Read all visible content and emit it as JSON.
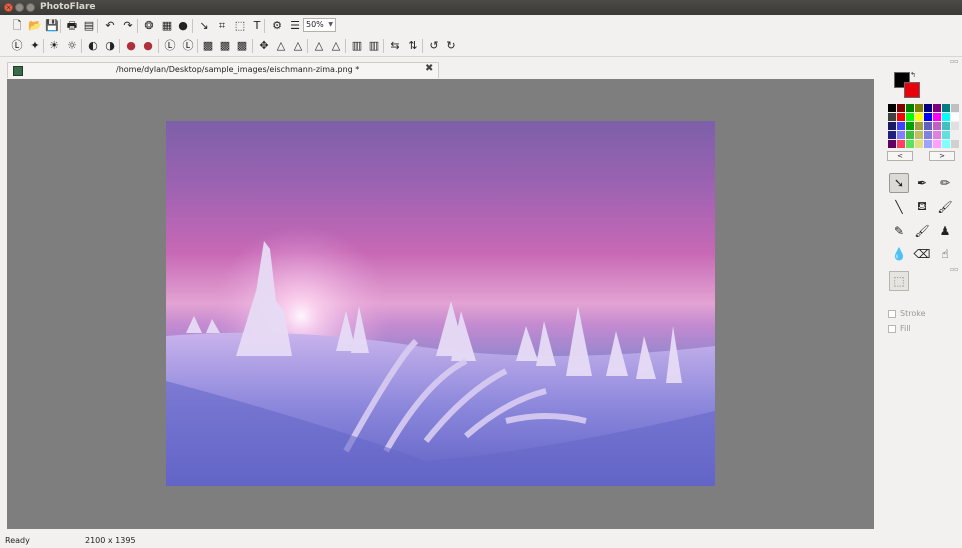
{
  "window": {
    "title": "PhotoFlare"
  },
  "toolbar1": [
    {
      "name": "new-file-icon",
      "glyph": "🗋"
    },
    {
      "name": "open-folder-icon",
      "glyph": "📂"
    },
    {
      "name": "save-icon",
      "glyph": "💾"
    },
    {
      "name": "print-icon",
      "glyph": "🖶"
    },
    {
      "name": "print-preview-icon",
      "glyph": "▤"
    },
    {
      "name": "undo-icon",
      "glyph": "↶"
    },
    {
      "name": "redo-icon",
      "glyph": "↷"
    },
    {
      "name": "color-balance-icon",
      "glyph": "❂"
    },
    {
      "name": "mosaic-icon",
      "glyph": "▦"
    },
    {
      "name": "rgb-icon",
      "glyph": "●"
    },
    {
      "name": "pointer-tool-icon",
      "glyph": "↘"
    },
    {
      "name": "crop-icon",
      "glyph": "⌗"
    },
    {
      "name": "resize-icon",
      "glyph": "⬚"
    },
    {
      "name": "text-icon",
      "glyph": "T"
    },
    {
      "name": "settings-gear-icon",
      "glyph": "⚙"
    },
    {
      "name": "layers-icon",
      "glyph": "☰"
    }
  ],
  "zoom": {
    "value": "50%"
  },
  "toolbar2": [
    {
      "name": "auto-levels-icon",
      "glyph": "Ⓛ"
    },
    {
      "name": "auto-contrast-icon",
      "glyph": "✦"
    },
    {
      "name": "brightness-up-icon",
      "glyph": "☀"
    },
    {
      "name": "brightness-down-icon",
      "glyph": "☼"
    },
    {
      "name": "contrast-up-icon",
      "glyph": "◐"
    },
    {
      "name": "contrast-down-icon",
      "glyph": "◑"
    },
    {
      "name": "saturation-up-icon",
      "glyph": "●"
    },
    {
      "name": "saturation-down-icon",
      "glyph": "●"
    },
    {
      "name": "gamma-up-icon",
      "glyph": "Ⓛ"
    },
    {
      "name": "gamma-down-icon",
      "glyph": "Ⓛ"
    },
    {
      "name": "grayscale-icon",
      "glyph": "▩"
    },
    {
      "name": "sepia-icon",
      "glyph": "▩"
    },
    {
      "name": "oil-paint-icon",
      "glyph": "▩"
    },
    {
      "name": "move-icon",
      "glyph": "✥"
    },
    {
      "name": "sharpen-icon",
      "glyph": "△"
    },
    {
      "name": "soften-icon",
      "glyph": "△"
    },
    {
      "name": "blur-icon",
      "glyph": "△"
    },
    {
      "name": "emboss-icon",
      "glyph": "△"
    },
    {
      "name": "gradient-color-icon",
      "glyph": "▥"
    },
    {
      "name": "gradient-gray-icon",
      "glyph": "▥"
    },
    {
      "name": "flip-horizontal-icon",
      "glyph": "⇆"
    },
    {
      "name": "flip-vertical-icon",
      "glyph": "⇅"
    },
    {
      "name": "rotate-ccw-icon",
      "glyph": "↺"
    },
    {
      "name": "rotate-cw-icon",
      "glyph": "↻"
    }
  ],
  "tab": {
    "title": "/home/dylan/Desktop/sample_images/eischmann-zima.png *",
    "close": "✖"
  },
  "colors": {
    "foreground": "#000000",
    "background": "#e8000c"
  },
  "palette": {
    "swatches": [
      "#000000",
      "#800000",
      "#008000",
      "#808000",
      "#000080",
      "#800080",
      "#008080",
      "#c0c0c0",
      "#404040",
      "#ff0000",
      "#00ff00",
      "#ffff00",
      "#0000ff",
      "#ff00ff",
      "#00ffff",
      "#ffffff",
      "#1a1a60",
      "#4040ff",
      "#00a000",
      "#a0a040",
      "#6060c0",
      "#c060c0",
      "#40c0c0",
      "#e0e0e0",
      "#202080",
      "#8080ff",
      "#40c040",
      "#c0c060",
      "#8080e0",
      "#e080e0",
      "#60e0e0",
      "#f0f0f0",
      "#600060",
      "#ff4060",
      "#60e060",
      "#e0e080",
      "#a0a0ff",
      "#ffa0ff",
      "#80ffff",
      "#d0d0d0"
    ],
    "prev_label": "<",
    "next_label": ">"
  },
  "tools": [
    {
      "name": "pointer-tool-icon",
      "glyph": "➘"
    },
    {
      "name": "eyedropper-tool-icon",
      "glyph": "✒"
    },
    {
      "name": "magic-wand-tool-icon",
      "glyph": "✏"
    },
    {
      "name": "line-tool-icon",
      "glyph": "╲"
    },
    {
      "name": "paint-bucket-tool-icon",
      "glyph": "⛾"
    },
    {
      "name": "spray-tool-icon",
      "glyph": "🖌"
    },
    {
      "name": "pencil-tool-icon",
      "glyph": "✎"
    },
    {
      "name": "brush-tool-icon",
      "glyph": "🖌"
    },
    {
      "name": "stamp-tool-icon",
      "glyph": "♟"
    },
    {
      "name": "blur-drop-tool-icon",
      "glyph": "💧"
    },
    {
      "name": "eraser-tool-icon",
      "glyph": "⌫"
    },
    {
      "name": "smudge-tool-icon",
      "glyph": "☝"
    },
    {
      "name": "select-rect-tool-icon",
      "glyph": "⬚"
    }
  ],
  "options": {
    "stroke_label": "Stroke",
    "fill_label": "Fill"
  },
  "status": {
    "text": "Ready",
    "dimensions": "2100 x 1395"
  }
}
